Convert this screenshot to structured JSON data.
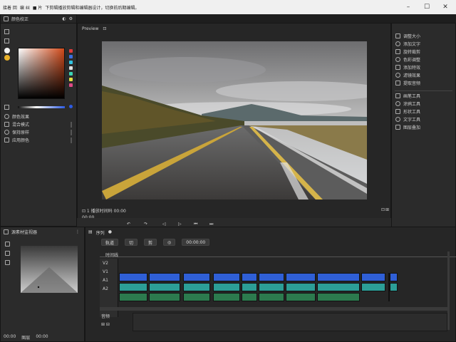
{
  "titlebar": {
    "items": [
      "接着 回",
      "编 纠",
      "■ 片",
      "下剪辑播放剪辑和编辑器设计，切换前后期编辑。"
    ],
    "min": "–",
    "max": "☐",
    "close": "✕"
  },
  "left_panel": {
    "header": "颜色校正",
    "header_icons": [
      "◐",
      "⚙"
    ],
    "tool_labels": [
      "颜色效果",
      "混合模式",
      "保持原样",
      "应用颜色"
    ],
    "palette_colors": [
      "#e03b3b",
      "#3b6ee0",
      "#30c3e0",
      "#e0e0e0",
      "#3bd4b4",
      "#e0e040",
      "#e04a86"
    ]
  },
  "viewer": {
    "tab_label": "Preview",
    "tab_icon_label": "⊡",
    "status_label": "⊡ 1  播放时间码 00:00",
    "timecode_left": "00:00",
    "buttons": [
      "⊡",
      "⊞",
      "↶",
      "↷",
      "◁",
      "▷",
      "⏮",
      "⏭"
    ]
  },
  "right_panel": {
    "items": [
      "调整大小",
      "添加文字",
      "旋转裁剪",
      "色彩调整",
      "添加特效",
      "滤镜效果",
      "提取音频"
    ],
    "tools": [
      "画笔工具",
      "涂鸦工具",
      "形状工具",
      "文字工具",
      "图层叠加"
    ]
  },
  "source_panel": {
    "header": "源素材监视器",
    "bottom_labels": [
      "00:00",
      "图层",
      "00:00"
    ]
  },
  "timeline": {
    "tab_label": "序列",
    "toolbar_buttons": [
      "轨道",
      "切",
      "剪",
      "◎",
      "00:00:00"
    ],
    "ruler_label": "时间线",
    "track_labels": [
      "V2",
      "V1",
      "A1",
      "A2"
    ],
    "track_icons": [
      "Ⓥ",
      "Ⓢ"
    ],
    "bottom_labels": [
      "音频",
      "⊞ ⊟"
    ],
    "colors": {
      "video": "#2f5fd6",
      "teal": "#2c9e97",
      "green": "#2c7a4e"
    }
  }
}
